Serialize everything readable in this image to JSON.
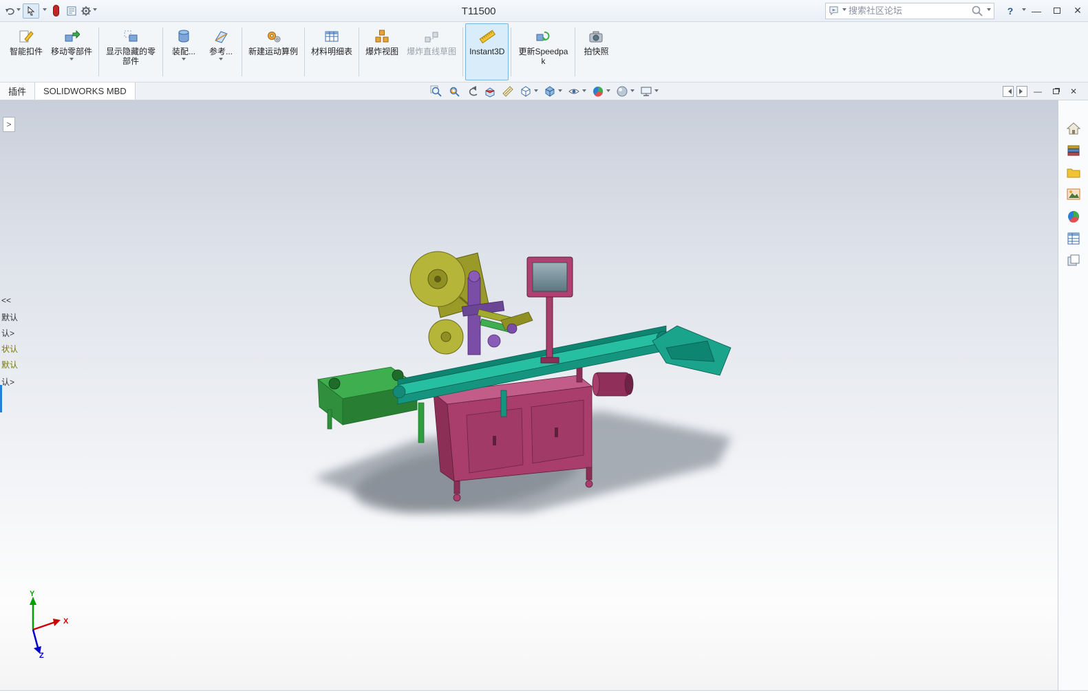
{
  "titlebar": {
    "title": "T11500",
    "search_placeholder": "搜索社区论坛",
    "help_label": "?"
  },
  "ribbon": {
    "buttons": [
      {
        "label": "智能扣件"
      },
      {
        "label": "移动零部件"
      },
      {
        "label": "显示隐藏的零部件"
      },
      {
        "label": "装配..."
      },
      {
        "label": "参考..."
      },
      {
        "label": "新建运动算例"
      },
      {
        "label": "材料明细表"
      },
      {
        "label": "爆炸视图"
      },
      {
        "label": "爆炸直线草图"
      },
      {
        "label": "Instant3D"
      },
      {
        "label": "更新Speedpak"
      },
      {
        "label": "拍快照"
      }
    ]
  },
  "tabs": {
    "addins": "插件",
    "mbd": "SOLIDWORKS MBD"
  },
  "left_panel": {
    "fragments": [
      "<<",
      "默认",
      "认>",
      "状认",
      "默认",
      "认>"
    ]
  },
  "triad": {
    "x": "X",
    "y": "Y",
    "z": "Z"
  },
  "icons": {
    "quick_toolbar": [
      "undo-icon",
      "select-cursor-icon",
      "record-pill-icon",
      "properties-list-icon",
      "gear-icon"
    ],
    "headsup": [
      "zoom-fit-icon",
      "zoom-area-icon",
      "previous-view-icon",
      "section-view-icon",
      "annotation-icon",
      "view-orientation-icon",
      "display-style-icon",
      "hide-show-items-icon",
      "edit-appearance-icon",
      "apply-scene-icon",
      "view-settings-icon"
    ],
    "taskpane": [
      "home-icon",
      "design-library-icon",
      "file-explorer-icon",
      "view-palette-icon",
      "appearances-icon",
      "custom-properties-icon",
      "document-panels-icon"
    ]
  },
  "colors": {
    "conveyor_teal": "#1aa48b",
    "cabinet_magenta": "#a93e6d",
    "reel_olive": "#b5b53a",
    "infeed_green": "#3fae4e",
    "head_purple": "#7a4ea6",
    "active_tool_highlight": "#d9ecf9",
    "viewport_top": "#c9cfda"
  }
}
